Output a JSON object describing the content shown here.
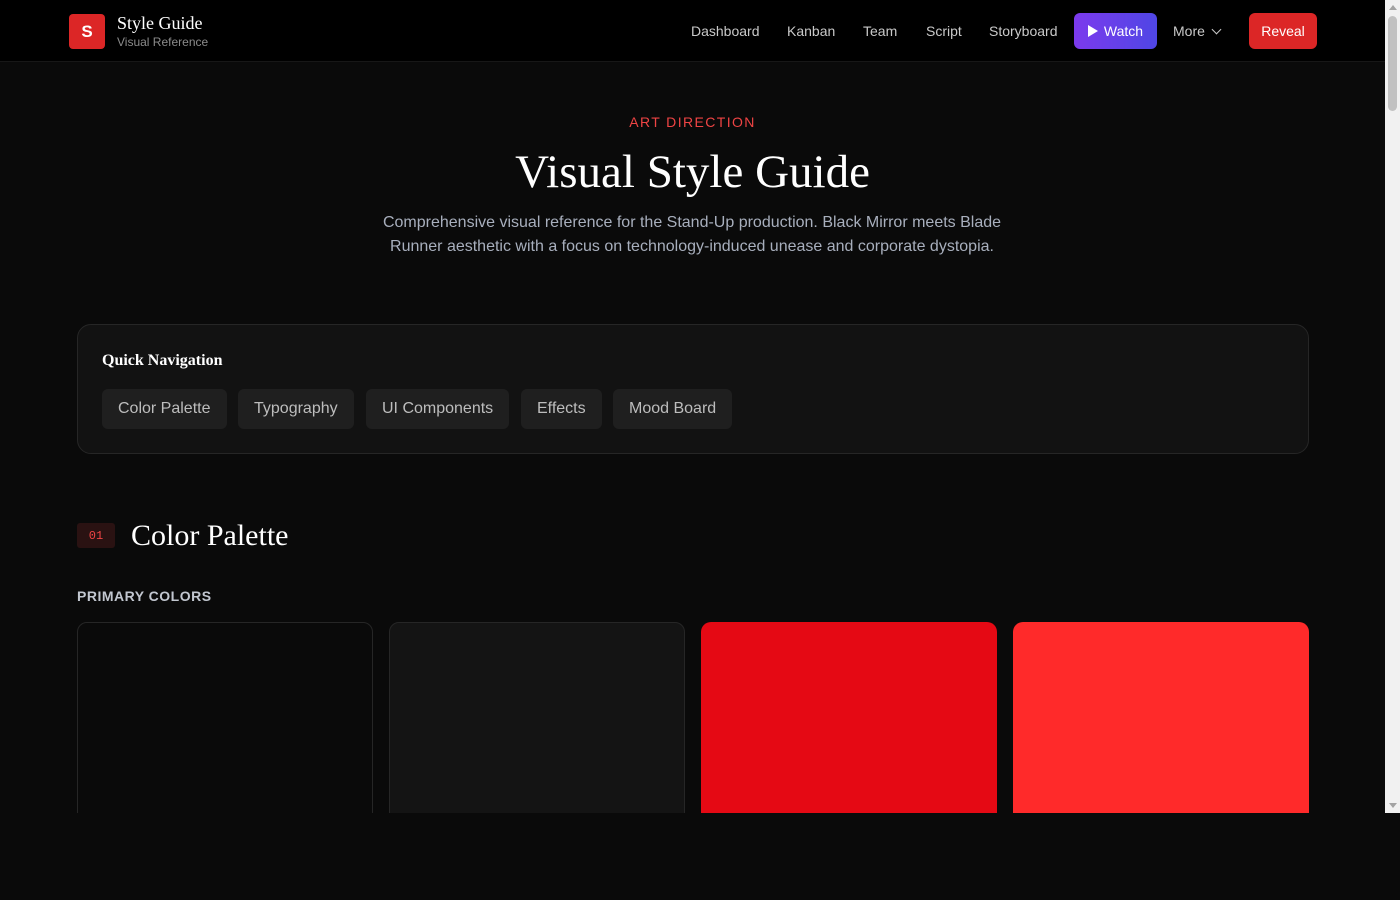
{
  "header": {
    "logo_letter": "S",
    "title": "Style Guide",
    "subtitle": "Visual Reference",
    "nav_links": [
      "Dashboard",
      "Kanban",
      "Team",
      "Script",
      "Storyboard"
    ],
    "watch_label": "Watch",
    "more_label": "More",
    "reveal_label": "Reveal"
  },
  "hero": {
    "eyebrow": "ART DIRECTION",
    "title": "Visual Style Guide",
    "description": "Comprehensive visual reference for the Stand-Up production. Black Mirror meets Blade Runner aesthetic with a focus on technology-induced unease and corporate dystopia."
  },
  "quick_nav": {
    "title": "Quick Navigation",
    "items": [
      "Color Palette",
      "Typography",
      "UI Components",
      "Effects",
      "Mood Board"
    ]
  },
  "section": {
    "number": "01",
    "title": "Color Palette",
    "subheading": "PRIMARY COLORS"
  },
  "swatches": [
    {
      "color": "#0a0a0a"
    },
    {
      "color": "#141414"
    },
    {
      "color": "#e50914"
    },
    {
      "color": "#ff2a2a"
    }
  ],
  "colors": {
    "accent_red": "#dc2626",
    "watch_gradient_start": "#7c3aed",
    "watch_gradient_end": "#4f46e5",
    "background": "#0a0a0a"
  }
}
